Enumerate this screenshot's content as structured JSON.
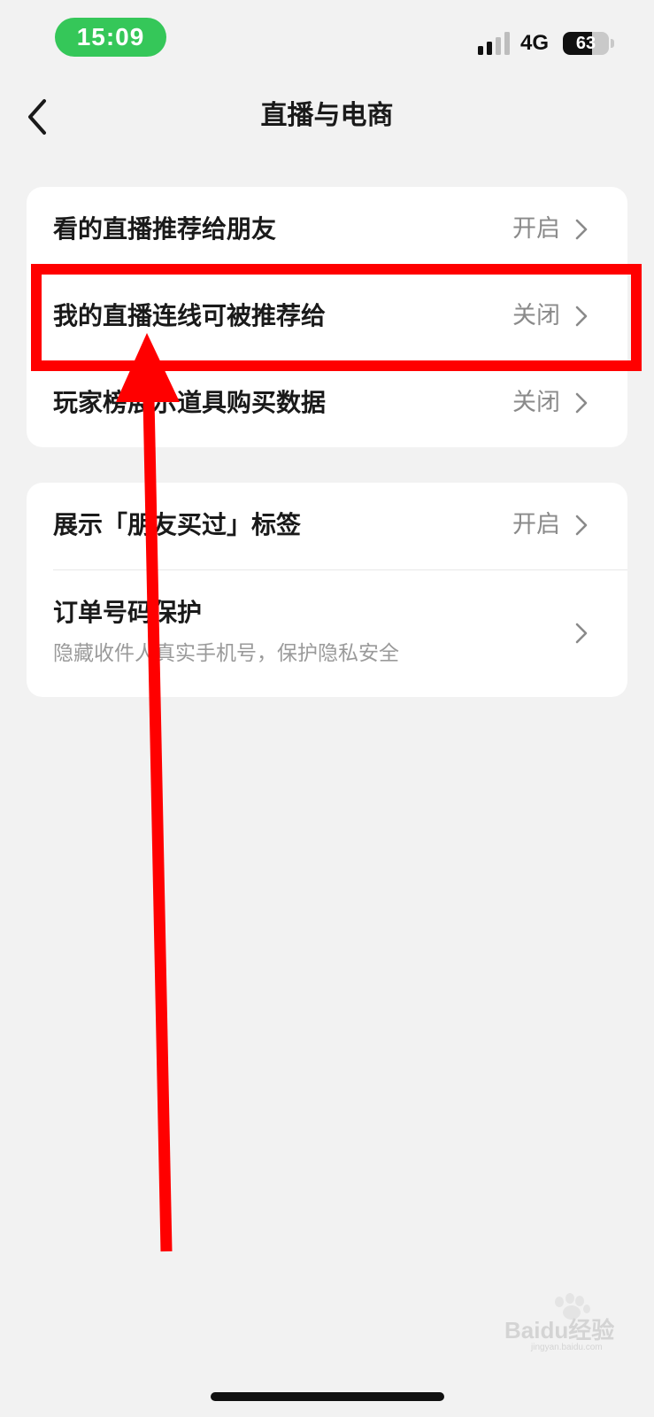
{
  "status_bar": {
    "time": "15:09",
    "network": "4G",
    "battery_level": "63",
    "battery_fraction": 0.63,
    "time_pill_color": "#35c759"
  },
  "header": {
    "title": "直播与电商",
    "back_icon": "chevron-left-icon"
  },
  "sections": [
    {
      "items": [
        {
          "label": "看的直播推荐给朋友",
          "value": "开启"
        },
        {
          "label": "我的直播连线可被推荐给",
          "value": "关闭"
        },
        {
          "label": "玩家榜展示道具购买数据",
          "value": "关闭"
        }
      ]
    },
    {
      "items": [
        {
          "label": "展示「朋友买过」标签",
          "value": "开启"
        },
        {
          "label": "订单号码保护",
          "subtitle": "隐藏收件人真实手机号，保护隐私安全"
        }
      ]
    }
  ],
  "annotation": {
    "color": "#ff0000",
    "highlighted_item": "我的直播连线可被推荐给"
  },
  "watermark": {
    "text": "Baidu经验",
    "subtext": "jingyan.baidu.com"
  }
}
